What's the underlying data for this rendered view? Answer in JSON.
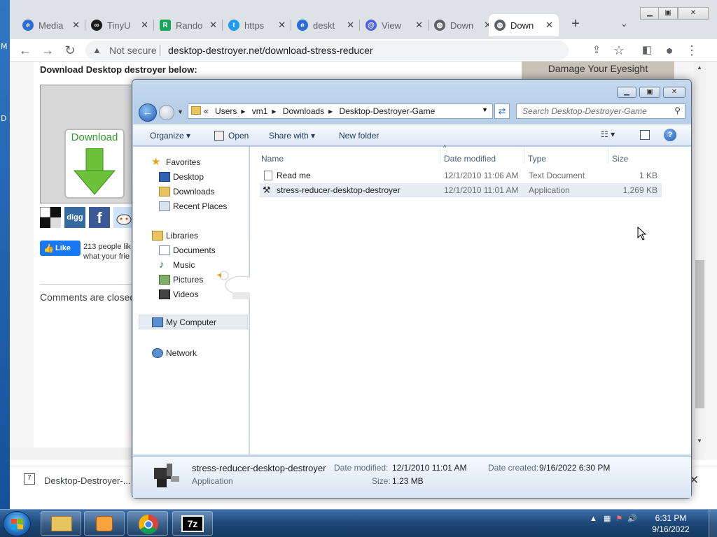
{
  "desktop": {
    "edge_labels": [
      "M",
      "D"
    ]
  },
  "browser": {
    "tabs": [
      {
        "title": "Media",
        "favicon_color": "#2c6cd8",
        "icon": "edge-icon"
      },
      {
        "title": "TinyU",
        "favicon_color": "#1b1b1b",
        "icon": "tinyurl-icon"
      },
      {
        "title": "Rando",
        "favicon_color": "#1aa35b",
        "icon": "letter-r-icon",
        "glyph": "R"
      },
      {
        "title": "https",
        "favicon_color": "#1d9bf0",
        "icon": "twitter-icon"
      },
      {
        "title": "deskt",
        "favicon_color": "#2c6cd8",
        "icon": "edge-icon"
      },
      {
        "title": "View",
        "favicon_color": "#4a63e0",
        "icon": "at-icon"
      },
      {
        "title": "Down",
        "favicon_color": "#5f6368",
        "icon": "globe-icon"
      },
      {
        "title": "Down",
        "favicon_color": "#5f6368",
        "icon": "globe-icon",
        "active": true
      }
    ],
    "not_secure": "Not secure",
    "url": "desktop-destroyer.net/download-stress-reducer"
  },
  "page": {
    "download_heading": "Download Desktop destroyer below:",
    "download_button": "Download",
    "fb_like": "Like",
    "like_text_line1": "213 people lik",
    "like_text_line2": "what your frie",
    "comments_closed": "Comments are closed.",
    "ad_text": "Damage Your Eyesight",
    "social": [
      "delicious",
      "digg",
      "facebook",
      "reddit"
    ]
  },
  "download_shelf": {
    "filename": "Desktop-Destroyer-..."
  },
  "explorer": {
    "breadcrumb": [
      "«",
      "Users",
      "vm1",
      "Downloads",
      "Desktop-Destroyer-Game"
    ],
    "search_placeholder": "Search Desktop-Destroyer-Game",
    "commands": {
      "organize": "Organize",
      "open": "Open",
      "share_with": "Share with",
      "new_folder": "New folder"
    },
    "nav": {
      "favorites": "Favorites",
      "desktop": "Desktop",
      "downloads": "Downloads",
      "recent": "Recent Places",
      "libraries": "Libraries",
      "documents": "Documents",
      "music": "Music",
      "pictures": "Pictures",
      "videos": "Videos",
      "computer": "My Computer",
      "network": "Network"
    },
    "columns": {
      "name": "Name",
      "date": "Date modified",
      "type": "Type",
      "size": "Size"
    },
    "files": [
      {
        "name": "Read me",
        "date": "12/1/2010 11:06 AM",
        "type": "Text Document",
        "size": "1 KB"
      },
      {
        "name": "stress-reducer-desktop-destroyer",
        "date": "12/1/2010 11:01 AM",
        "type": "Application",
        "size": "1,269 KB"
      }
    ],
    "details": {
      "name": "stress-reducer-desktop-destroyer",
      "type": "Application",
      "modified_label": "Date modified:",
      "modified": "12/1/2010 11:01 AM",
      "created_label": "Date created:",
      "created": "9/16/2022 6:30 PM",
      "size_label": "Size:",
      "size": "1.23 MB"
    }
  },
  "taskbar": {
    "time": "6:31 PM",
    "date": "9/16/2022",
    "apps": [
      "explorer-icon",
      "media-player-icon",
      "chrome-icon",
      "7zip-icon"
    ],
    "seven_zip_label": "7z"
  }
}
